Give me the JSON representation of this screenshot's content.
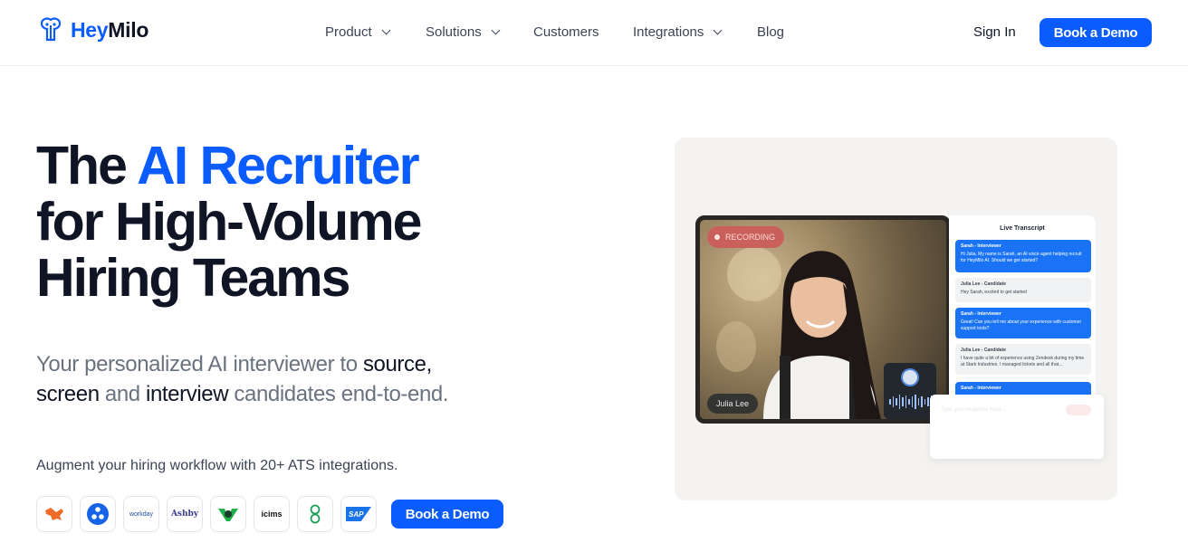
{
  "nav": {
    "logo": {
      "hey": "Hey",
      "milo": "Milo"
    },
    "items": [
      {
        "label": "Product",
        "dropdown": true
      },
      {
        "label": "Solutions",
        "dropdown": true
      },
      {
        "label": "Customers",
        "dropdown": false
      },
      {
        "label": "Integrations",
        "dropdown": true
      },
      {
        "label": "Blog",
        "dropdown": false
      }
    ],
    "sign_in": "Sign In",
    "cta": "Book a Demo"
  },
  "hero": {
    "headline_part1": "The ",
    "headline_accent": "AI Recruiter",
    "headline_line2": "for High-Volume",
    "headline_line3": "Hiring Teams",
    "sub_1": "Your personalized AI interviewer to ",
    "sub_source": "source,",
    "sub_screen": "screen",
    "sub_and": " and ",
    "sub_interview": "interview",
    "sub_end": " candidates end-to-end.",
    "ats_text": "Augment your hiring workflow with 20+ ATS integrations.",
    "ats_logos": [
      "greenhouse-icon",
      "bamboo-icon",
      "workday",
      "Ashby",
      "lever-icon",
      "icims",
      "gem-icon",
      "SAP"
    ],
    "cta": "Book a Demo"
  },
  "demo": {
    "recording": "RECORDING",
    "candidate_name": "Julia Lee",
    "transcript_title": "Live Transcript",
    "messages": [
      {
        "who": "Sarah - Interviewer",
        "text": "Hi Julia, My name is Sarah, an AI voice agent helping recruit for HeyMilo AI. Should we get started?",
        "role": "ai"
      },
      {
        "who": "Julia Lee - Candidate",
        "text": "Hey Sarah, excited to get started",
        "role": "user"
      },
      {
        "who": "Sarah - Interviewer",
        "text": "Great! Can you tell me about your experience with customer support tools?",
        "role": "ai"
      },
      {
        "who": "Julia Lee - Candidate",
        "text": "I have quite a bit of experience using Zendesk during my time at Stark Industries. I managed tickets and all that...",
        "role": "user"
      },
      {
        "who": "Sarah - Interviewer",
        "text": "",
        "role": "ai"
      }
    ],
    "input_hint": "Type your response here..."
  },
  "colors": {
    "accent": "#0b5cff",
    "ink": "#0f1524",
    "muted": "#6a7280"
  }
}
